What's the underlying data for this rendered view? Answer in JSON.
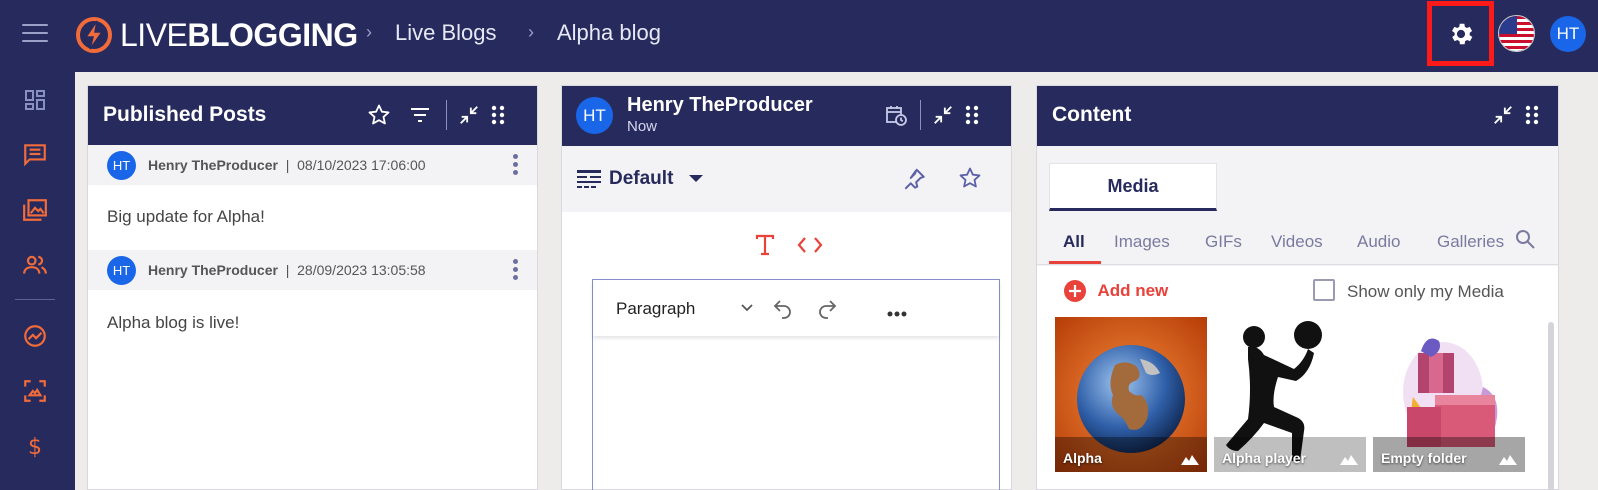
{
  "topbar": {
    "logo_part1": "LIVE",
    "logo_part2": "BLOGGING",
    "breadcrumb": [
      "Live Blogs",
      "Alpha blog"
    ],
    "user_initials": "HT"
  },
  "sidebar": {
    "icons": [
      "dashboard-icon",
      "posts-icon",
      "media-library-icon",
      "users-icon",
      "analytics-icon",
      "gallery-icon",
      "billing-icon"
    ]
  },
  "published_panel": {
    "title": "Published Posts",
    "posts": [
      {
        "initials": "HT",
        "author": "Henry TheProducer",
        "timestamp": "08/10/2023 17:06:00",
        "text": "Big update for Alpha!"
      },
      {
        "initials": "HT",
        "author": "Henry TheProducer",
        "timestamp": "28/09/2023 13:05:58",
        "text": "Alpha blog is live!"
      }
    ]
  },
  "editor_panel": {
    "initials": "HT",
    "author": "Henry TheProducer",
    "time": "Now",
    "template_label": "Default",
    "block_type": "Paragraph"
  },
  "content_panel": {
    "title": "Content",
    "tab": "Media",
    "filters": [
      "All",
      "Images",
      "GIFs",
      "Videos",
      "Audio",
      "Galleries"
    ],
    "add_new": "Add new",
    "show_only_mine": "Show only my Media",
    "items": [
      {
        "label": "Alpha"
      },
      {
        "label": "Alpha player"
      },
      {
        "label": "Empty folder"
      }
    ]
  },
  "colors": {
    "navy": "#272a5c",
    "accent_red": "#e8423b",
    "highlight_box": "#ff1a1a",
    "avatar_blue": "#1a66e8"
  }
}
